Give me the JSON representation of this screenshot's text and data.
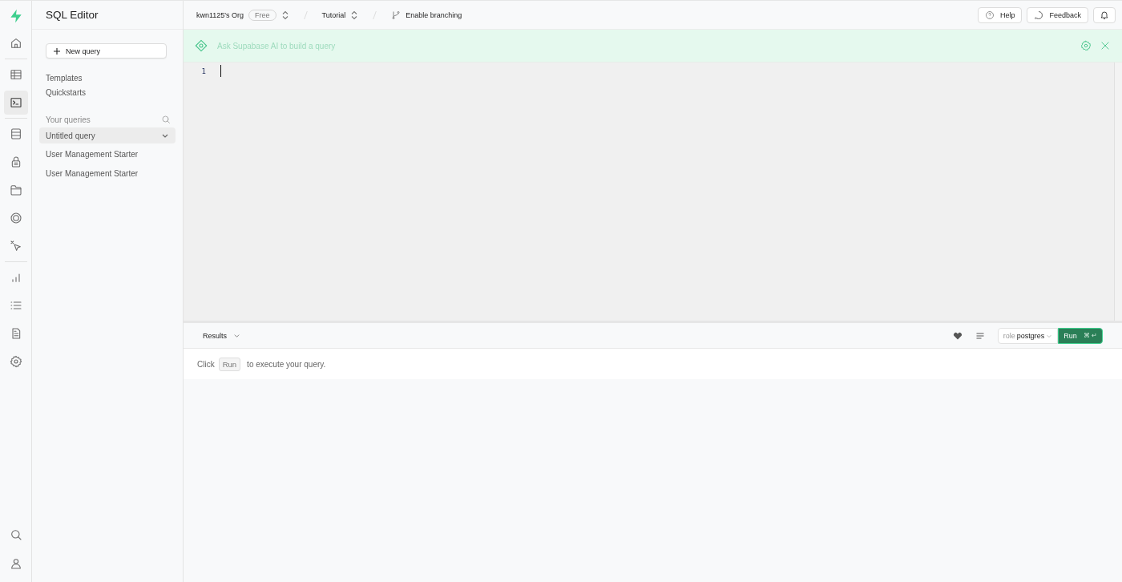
{
  "rail": {
    "top": [
      {
        "selected": false
      }
    ],
    "groups": [
      [
        {
          "selected": false
        },
        {
          "selected": true
        }
      ],
      [
        {
          "selected": false
        },
        {
          "selected": false
        },
        {
          "selected": false
        },
        {
          "selected": false
        },
        {
          "selected": false
        }
      ],
      [
        {
          "selected": false
        },
        {
          "selected": false
        },
        {
          "selected": false
        },
        {
          "selected": false
        }
      ]
    ],
    "bottom": [
      {
        "selected": false
      },
      {
        "selected": false
      }
    ]
  },
  "sidebar": {
    "title": "SQL Editor",
    "new_query": "New query",
    "links": [
      "Templates",
      "Quickstarts"
    ],
    "section": "Your queries",
    "queries": [
      {
        "label": "Untitled query",
        "selected": true
      },
      {
        "label": "User Management Starter",
        "selected": false
      },
      {
        "label": "User Management Starter",
        "selected": false
      }
    ]
  },
  "breadcrumbs": {
    "org": "kwn1125's Org",
    "plan": "Free",
    "project": "Tutorial",
    "branching": "Enable branching"
  },
  "header_buttons": {
    "help": "Help",
    "feedback": "Feedback"
  },
  "ai_bar": {
    "placeholder": "Ask Supabase AI to build a query"
  },
  "editor": {
    "line_numbers": [
      "1"
    ]
  },
  "results": {
    "tab": "Results",
    "role_label": "role",
    "role": "postgres",
    "run": "Run",
    "shortcut": "⌘ ↵",
    "message": [
      "Click",
      "Run",
      "to execute your query."
    ]
  }
}
